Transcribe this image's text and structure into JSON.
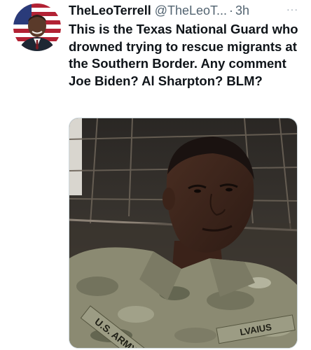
{
  "author": {
    "display_name": "TheLeoTerrell",
    "handle": "@TheLeoT...",
    "separator": "·",
    "time": "3h"
  },
  "more_menu": "···",
  "tweet": {
    "text": "This is the Texas National Guard who drowned trying to rescue migrants at the Southern Border. Any comment Joe Biden? Al Sharpton?  BLM?"
  },
  "media": {
    "uniform_tape_text": "U.S. ARMY",
    "name_tape_text": "LVAIUS"
  }
}
